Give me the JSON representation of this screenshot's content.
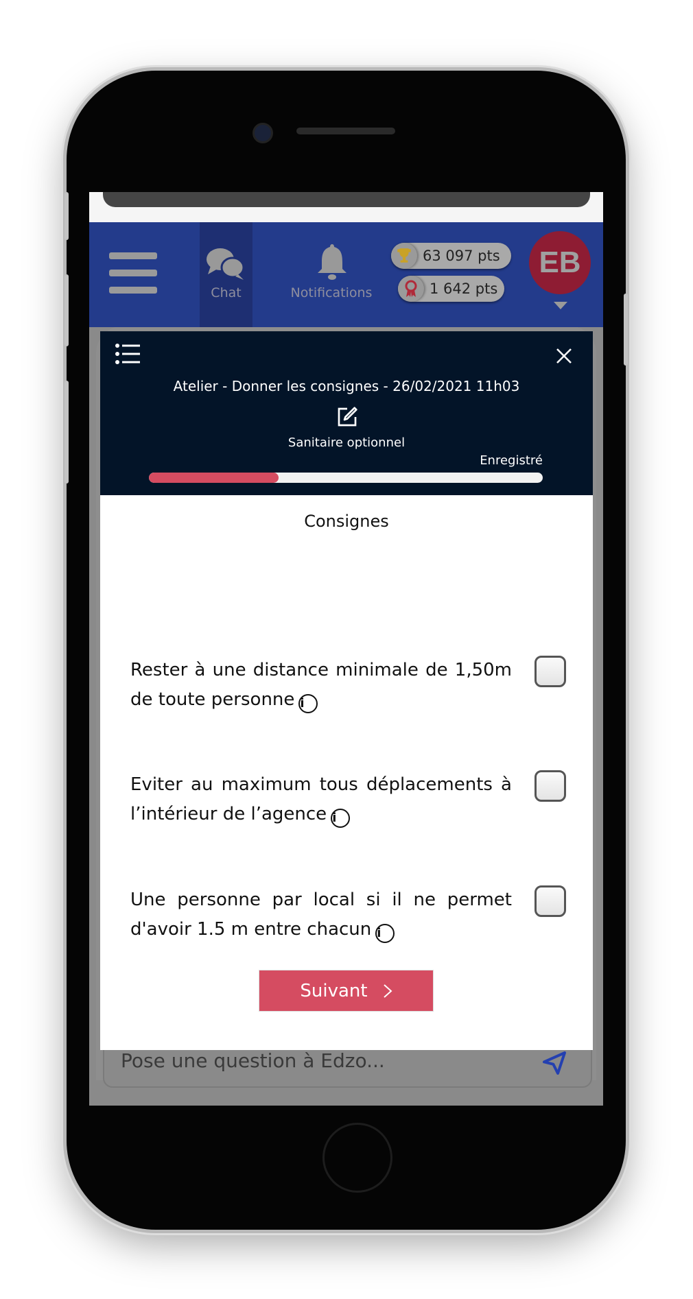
{
  "header": {
    "nav": [
      {
        "label": "Chat",
        "icon": "chat-bubbles-icon"
      },
      {
        "label": "Notifications",
        "icon": "bell-icon"
      }
    ],
    "points": [
      {
        "value": "63 097 pts",
        "icon": "trophy-icon"
      },
      {
        "value": "1 642 pts",
        "icon": "medal-icon"
      }
    ],
    "avatar_initials": "EB"
  },
  "modal": {
    "title": "Atelier - Donner les consignes - 26/02/2021 11h03",
    "subtitle": "Sanitaire optionnel",
    "status": "Enregistré",
    "progress_percent": 33,
    "section_title": "Consignes",
    "items": [
      {
        "text": "Rester à une distance minimale de 1,50m de toute personne",
        "checked": false
      },
      {
        "text": "Eviter au maximum tous déplacements à l’intérieur de l’agence",
        "checked": false
      },
      {
        "text": "Une personne par local si il ne permet d'avoir 1.5 m entre chacun",
        "checked": false
      }
    ],
    "next_label": "Suivant"
  },
  "chat": {
    "placeholder": "Pose une question à Edzo..."
  },
  "colors": {
    "header": "#233b8b",
    "modal_header": "#031428",
    "accent": "#d54c61",
    "avatar": "#8e1c33"
  }
}
